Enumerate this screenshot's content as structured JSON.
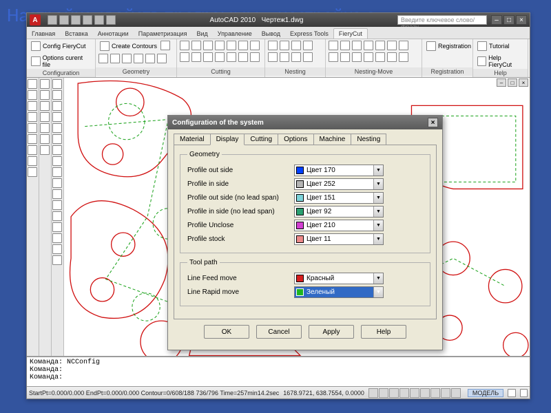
{
  "slide": {
    "title": "Настройка свойств программы – настройка о"
  },
  "titlebar": {
    "app": "AutoCAD 2010",
    "doc": "Чертеж1.dwg",
    "search_placeholder": "Введите ключевое слово/фразу",
    "logo": "A"
  },
  "ribbon_tabs": [
    "Главная",
    "Вставка",
    "Аннотации",
    "Параметризация",
    "Вид",
    "Управление",
    "Вывод",
    "Express Tools",
    "FieryCut"
  ],
  "ribbon_active": 8,
  "panels": [
    {
      "title": "Configuration",
      "items": [
        "Config FieryCut",
        "Options curent file"
      ]
    },
    {
      "title": "Geometry",
      "items": [
        "Create Contours"
      ]
    },
    {
      "title": "Cutting",
      "items": []
    },
    {
      "title": "Nesting",
      "items": []
    },
    {
      "title": "Nesting-Move",
      "items": []
    },
    {
      "title": "Registration",
      "items": [
        "Registration"
      ]
    },
    {
      "title": "Help",
      "items": [
        "Tutorial",
        "Help FieryCut"
      ]
    }
  ],
  "dialog": {
    "title": "Configuration of the system",
    "tabs": [
      "Material",
      "Display",
      "Cutting",
      "Options",
      "Machine",
      "Nesting"
    ],
    "active_tab": 1,
    "group1": "Geometry",
    "group2": "Tool path",
    "rows_geometry": [
      {
        "label": "Profile out side",
        "value": "Цвет 170",
        "color": "#0040ff"
      },
      {
        "label": "Profile in side",
        "value": "Цвет 252",
        "color": "#b5b5b5"
      },
      {
        "label": "Profile out side (no lead span)",
        "value": "Цвет 151",
        "color": "#7dd3d9"
      },
      {
        "label": "Profile in side (no lead span)",
        "value": "Цвет 92",
        "color": "#2aa072"
      },
      {
        "label": "Profile Unclose",
        "value": "Цвет 210",
        "color": "#d23fd2"
      },
      {
        "label": "Profile stock",
        "value": "Цвет 11",
        "color": "#ec8a8a"
      }
    ],
    "rows_toolpath": [
      {
        "label": "Line Feed move",
        "value": "Красный",
        "color": "#d61f1f",
        "hl": false
      },
      {
        "label": "Line Rapid move",
        "value": "Зеленый",
        "color": "#1fb51f",
        "hl": true
      }
    ],
    "buttons": [
      "OK",
      "Cancel",
      "Apply",
      "Help"
    ]
  },
  "cmd": {
    "l1": "Команда: NCConfig",
    "l2": "Команда:",
    "l3": "Команда:"
  },
  "status": {
    "a": "StartPt=0.000/0.000  EndPt=0.000/0.000  Contour=0/608/188  736/796 Time=257min14.2sec",
    "b": "1678.9721, 638.7554, 0.0000",
    "model": "МОДЕЛЬ"
  }
}
